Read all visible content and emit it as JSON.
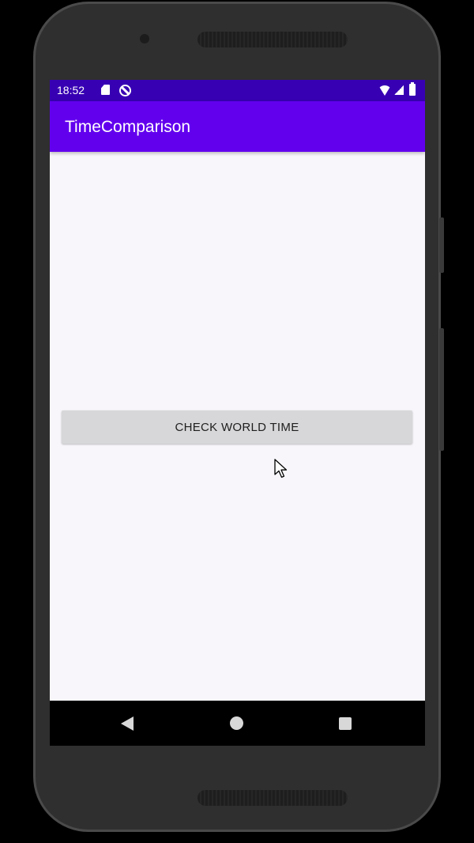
{
  "status_bar": {
    "time": "18:52",
    "icons": [
      "sd-card-icon",
      "do-not-disturb-icon",
      "wifi-icon",
      "cell-signal-icon",
      "battery-icon"
    ]
  },
  "app_bar": {
    "title": "TimeComparison"
  },
  "main": {
    "button_label": "CHECK WORLD TIME"
  },
  "nav_bar": {
    "icons": [
      "back-icon",
      "home-icon",
      "recent-apps-icon"
    ]
  },
  "colors": {
    "status_bar": "#3700b3",
    "app_bar": "#6200ee",
    "background": "#f8f6fa",
    "button": "#d7d7d9"
  }
}
